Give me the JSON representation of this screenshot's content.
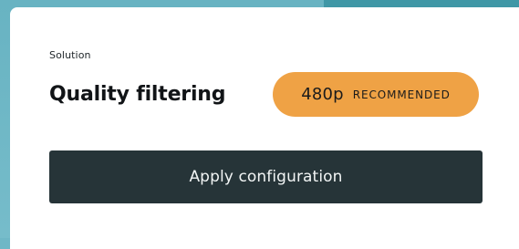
{
  "section": {
    "eyebrow": "Solution",
    "title": "Quality filtering"
  },
  "badge": {
    "resolution": "480p",
    "tag": "RECOMMENDED",
    "color": "#efa245"
  },
  "action": {
    "apply_label": "Apply configuration",
    "color": "#263438"
  },
  "theme": {
    "background_teal": "#6fb7c6",
    "accent_teal": "#3f97a6",
    "card": "#ffffff"
  }
}
